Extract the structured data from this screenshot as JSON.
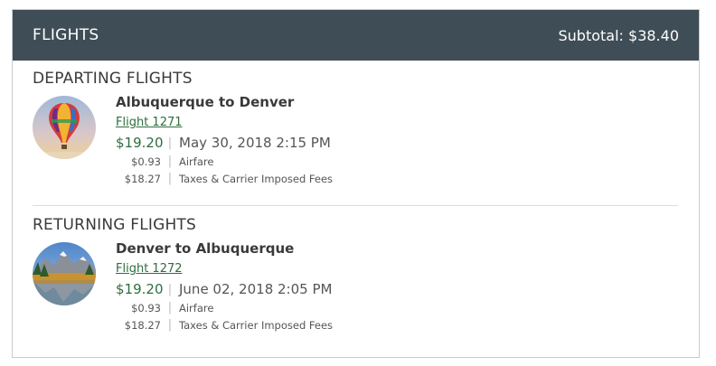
{
  "header": {
    "title": "FLIGHTS",
    "subtotal": "Subtotal: $38.40"
  },
  "departing": {
    "heading": "DEPARTING FLIGHTS",
    "route": "Albuquerque to Denver",
    "flight": "Flight 1271",
    "price": "$19.20",
    "datetime": "May 30, 2018 2:15 PM",
    "airfare_amount": "$0.93",
    "airfare_label": "Airfare",
    "fees_amount": "$18.27",
    "fees_label": "Taxes & Carrier Imposed Fees",
    "image_icon": "hot-air-balloon-image"
  },
  "returning": {
    "heading": "RETURNING FLIGHTS",
    "route": "Denver to Albuquerque",
    "flight": "Flight 1272",
    "price": "$19.20",
    "datetime": "June 02, 2018 2:05 PM",
    "airfare_amount": "$0.93",
    "airfare_label": "Airfare",
    "fees_amount": "$18.27",
    "fees_label": "Taxes & Carrier Imposed Fees",
    "image_icon": "mountain-lake-image"
  },
  "colors": {
    "header_bg": "#3f4d56",
    "price_green": "#2e6e3e",
    "link_green": "#2e6e3e"
  }
}
